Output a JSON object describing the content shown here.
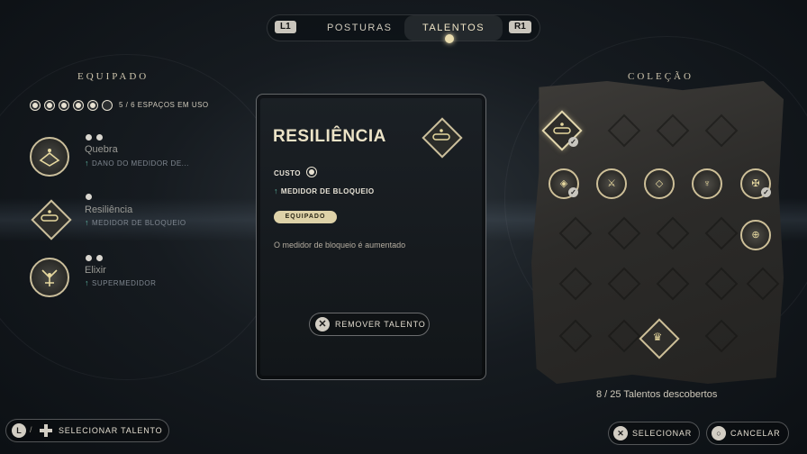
{
  "tabs": {
    "left_button": "L1",
    "right_button": "R1",
    "items": [
      "POSTURAS",
      "TALENTOS"
    ],
    "active": "TALENTOS"
  },
  "equipped": {
    "title": "EQUIPADO",
    "slots_total": 6,
    "slots_used": 5,
    "slots_text": "5 / 6 ESPAÇOS EM USO",
    "items": [
      {
        "name": "Quebra",
        "effect": "DANO DO MEDIDOR DE...",
        "cost": 2,
        "icon": "quebra-icon"
      },
      {
        "name": "Resiliência",
        "effect": "MEDIDOR DE BLOQUEIO",
        "cost": 1,
        "icon": "resiliencia-icon"
      },
      {
        "name": "Elixir",
        "effect": "SUPERMEDIDOR",
        "cost": 2,
        "icon": "elixir-icon"
      }
    ]
  },
  "detail": {
    "title": "RESILIÊNCIA",
    "cost_label": "CUSTO",
    "cost": 1,
    "effect": "MEDIDOR DE BLOQUEIO",
    "status_badge": "EQUIPADO",
    "description": "O medidor de bloqueio é aumentado",
    "remove_label": "REMOVER TALENTO"
  },
  "collection": {
    "title": "COLEÇÃO",
    "discovered_text": "8 / 25 Talentos descobertos"
  },
  "footer": {
    "select_talent_label": "SELECIONAR TALENTO",
    "select_label": "SELECIONAR",
    "cancel_label": "CANCELAR",
    "stick_label": "L"
  },
  "colors": {
    "accent_gold": "#cbbf9c",
    "badge_bg": "#ded2a8",
    "effect_arrow": "#5fb5a3"
  }
}
